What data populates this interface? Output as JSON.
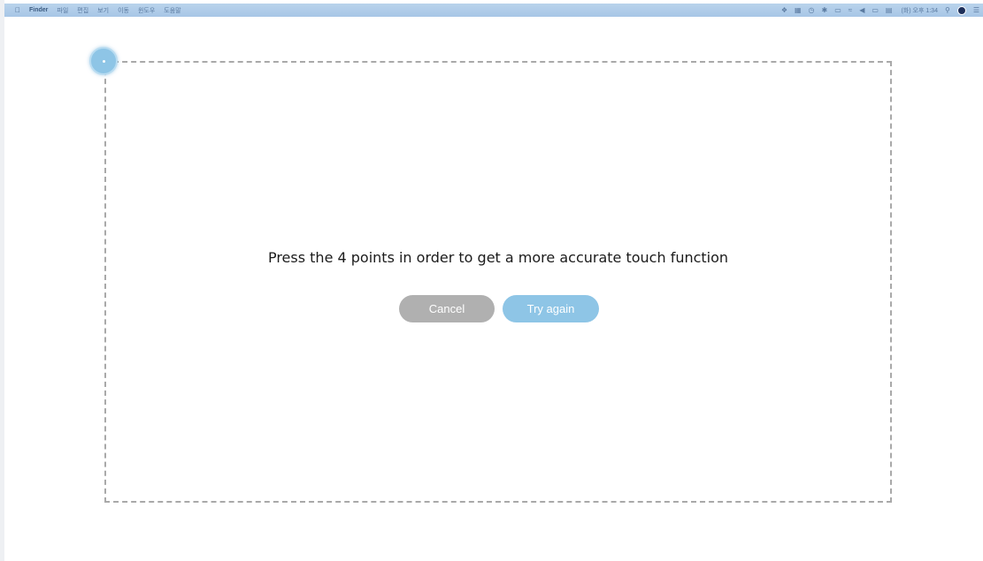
{
  "menubar": {
    "apple_glyph": "",
    "app_name": "Finder",
    "items": [
      "파일",
      "편집",
      "보기",
      "이동",
      "윈도우",
      "도움말"
    ],
    "status_icons": [
      "dropbox-icon",
      "chart-icon",
      "time-machine-icon",
      "bluetooth-icon",
      "airplay-icon",
      "wifi-icon",
      "volume-icon",
      "battery-icon",
      "keyboard-icon",
      "clock-icon"
    ],
    "clock_text": "(화) 오후 1:34"
  },
  "calibration": {
    "instruction": "Press the 4 points in order to get a more accurate touch function",
    "cancel_label": "Cancel",
    "retry_label": "Try again"
  },
  "colors": {
    "accent": "#8ec5e6",
    "cancel": "#b0b0b0",
    "border": "#a9a9a9"
  }
}
